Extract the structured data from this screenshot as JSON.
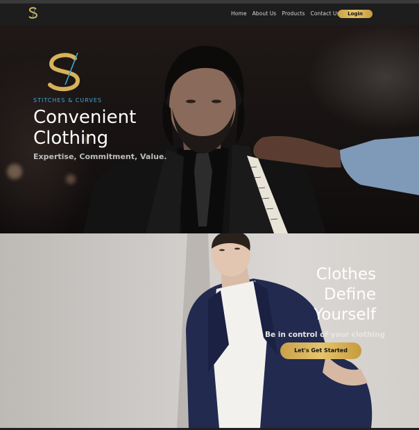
{
  "nav": {
    "logo_icon": "stitches-curves-logo-icon",
    "links": [
      "Home",
      "About Us",
      "Products",
      "Contact Us"
    ],
    "login_label": "Login"
  },
  "hero1": {
    "brand_name": "STITCHES & CURVES",
    "title_line1": "Convenient",
    "title_line2": "Clothing",
    "subtitle": "Expertise, Commitment, Value."
  },
  "hero2": {
    "title_line1": "Clothes",
    "title_line2": "Define",
    "title_line3": "Yourself",
    "subtitle": "Be in control of your clothing",
    "cta_label": "Let's Get Started"
  },
  "colors": {
    "gold": "#d7b25a",
    "brand_blue": "#3fa9d6",
    "nav_bg": "#1d1d1d"
  }
}
